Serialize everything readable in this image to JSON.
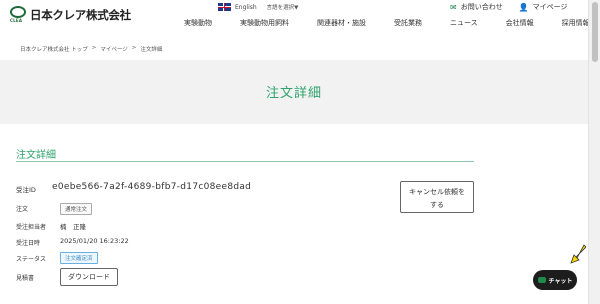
{
  "header": {
    "logo_text": "日本クレア株式会社",
    "logo_sub": "CLEA",
    "lang_label": "English",
    "lang_select": "言語を選択▼",
    "contact": "お問い合わせ",
    "mypage": "マイページ",
    "nav": [
      "実験動物",
      "実験動物用飼料",
      "関連器材・施設",
      "受託業務",
      "ニュース",
      "会社情報",
      "採用情報"
    ]
  },
  "breadcrumb": [
    "日本クレア株式会社 トップ",
    ">",
    "マイページ",
    ">",
    "注文詳細"
  ],
  "page_title": "注文詳細",
  "section_title": "注文詳細",
  "order": {
    "id_label": "受注ID",
    "id_value": "e0ebe566-7a2f-4689-bfb7-d17c08ee8dad",
    "cancel_button": [
      "キャンセル依頼を",
      "する"
    ],
    "type_label": "注文",
    "type_value": "通常注文",
    "person_label": "受注担当者",
    "person_value": "楠　正隆",
    "date_label": "受注日時",
    "date_value": "2025/01/20 16:23:22",
    "status_label": "ステータス",
    "status_value": "注文確定済",
    "estimate_label": "見積書",
    "download_button": "ダウンロード"
  },
  "chat": {
    "label": "チャット"
  },
  "colors": {
    "accent": "#2fa36b",
    "status_blue": "#3a8cc8",
    "chat_bg": "#1d1d1d",
    "arrow": "#f5d400"
  }
}
